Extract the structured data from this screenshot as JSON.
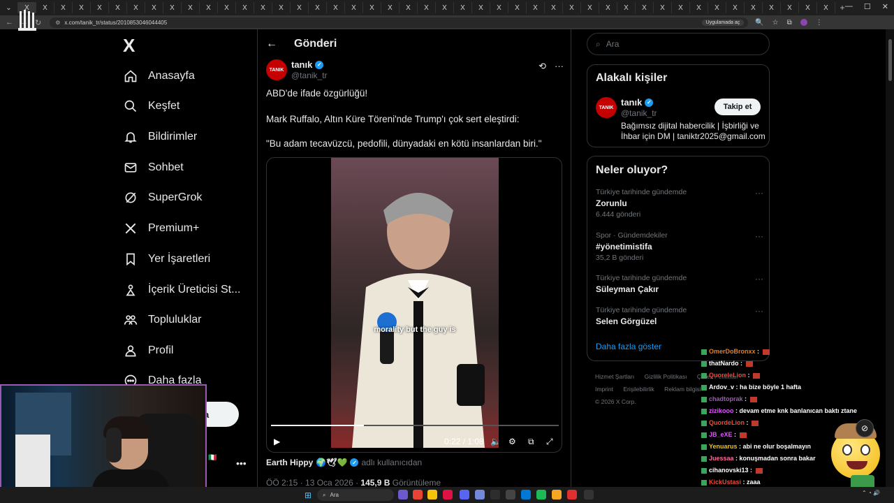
{
  "browser": {
    "url": "x.com/tanik_tr/status/2010853046044405",
    "app_pill": "Uygulamada aç",
    "tab_glyph": "X"
  },
  "nav": {
    "logo": "X",
    "items": [
      {
        "label": "Anasayfa",
        "icon": "home-icon"
      },
      {
        "label": "Keşfet",
        "icon": "search-icon"
      },
      {
        "label": "Bildirimler",
        "icon": "bell-icon"
      },
      {
        "label": "Sohbet",
        "icon": "mail-icon"
      },
      {
        "label": "SuperGrok",
        "icon": "grok-icon"
      },
      {
        "label": "Premium+",
        "icon": "x-premium-icon"
      },
      {
        "label": "Yer İşaretleri",
        "icon": "bookmark-icon"
      },
      {
        "label": "İçerik Üreticisi St...",
        "icon": "creator-icon"
      },
      {
        "label": "Topluluklar",
        "icon": "communities-icon"
      },
      {
        "label": "Profil",
        "icon": "profile-icon"
      },
      {
        "label": "Daha fazla",
        "icon": "more-circle-icon"
      }
    ],
    "post_button": "a"
  },
  "post": {
    "header_title": "Gönderi",
    "author": {
      "name": "tanık",
      "handle": "@tanik_tr",
      "avatar_text": "TANIK"
    },
    "text_lines": [
      "ABD'de ifade özgürlüğü!",
      "Mark Ruffalo, Altın Küre Töreni'nde Trump'ı çok sert eleştirdi:",
      "\"Bu adam tecavüzcü, pedofili, dünyadaki en kötü insanlardan biri.\""
    ],
    "video": {
      "caption": "morality but the guy is",
      "time": "0:22 / 1:08",
      "progress": 0.324
    },
    "media_source": {
      "name": "Earth Hippy",
      "suffix": "adlı kullanıcıdan"
    },
    "meta": {
      "time": "ÖÖ 2:15 · 13 Oca 2026 · ",
      "views": "145,9 B",
      "views_label": " Görüntüleme"
    }
  },
  "sidebar": {
    "search_placeholder": "Ara",
    "related": {
      "title": "Alakalı kişiler",
      "name": "tanık",
      "handle": "@tanik_tr",
      "bio": "Bağımsız dijital habercilik | İşbirliği ve İhbar için DM | taniktr2025@gmail.com",
      "follow": "Takip et",
      "avatar_text": "TANIK"
    },
    "trends": {
      "title": "Neler oluyor?",
      "items": [
        {
          "context": "Türkiye tarihinde gündemde",
          "name": "Zorunlu",
          "count": "6.444 gönderi"
        },
        {
          "context": "Spor · Gündemdekiler",
          "name": "#yönetimistifa",
          "count": "35,2 B gönderi"
        },
        {
          "context": "Türkiye tarihinde gündemde",
          "name": "Süleyman Çakır",
          "count": ""
        },
        {
          "context": "Türkiye tarihinde gündemde",
          "name": "Selen Görgüzel",
          "count": ""
        }
      ],
      "show_more": "Daha fazla göster"
    },
    "footer": {
      "row1": [
        "Hizmet Şartları",
        "Gizlilik Politikası",
        "Çerez Politikası"
      ],
      "row2": [
        "Imprint",
        "Erişilebilirlik",
        "Reklam bilgisi"
      ],
      "copyright": "© 2026 X Corp."
    }
  },
  "chat": [
    {
      "user": "OmerDoBronxx",
      "msg": "",
      "color": "#e67e22"
    },
    {
      "user": "thatNardo",
      "msg": "",
      "color": "#ffffff"
    },
    {
      "user": "QuoreleLion",
      "msg": "",
      "color": "#e74c3c"
    },
    {
      "user": "Ardov_v",
      "msg": "ha bize böyle 1 hafta",
      "color": "#ffffff"
    },
    {
      "user": "chadtoprak",
      "msg": "",
      "color": "#9b59b6"
    },
    {
      "user": "zizikooo",
      "msg": "devam etme knk banlanıcan baktı ztane",
      "color": "#e056fd"
    },
    {
      "user": "QuordeLion",
      "msg": "",
      "color": "#e74c3c"
    },
    {
      "user": "JB_eXE",
      "msg": "",
      "color": "#e056fd"
    },
    {
      "user": "Yenuarus",
      "msg": "abi ne olur boşalmayın",
      "color": "#f1c40f"
    },
    {
      "user": "Juessaa",
      "msg": "konuşmadan sonra bakar",
      "color": "#ff6b9d"
    },
    {
      "user": "cihanovski13",
      "msg": "",
      "color": "#ffffff"
    },
    {
      "user": "KickUstasi",
      "msg": "zaaa",
      "color": "#e74c3c"
    }
  ],
  "taskbar": {
    "search": "Ara"
  },
  "colors": {
    "accent": "#1d9bf0",
    "brand_red": "#c40000",
    "webcam_border": "#9b59b6"
  }
}
